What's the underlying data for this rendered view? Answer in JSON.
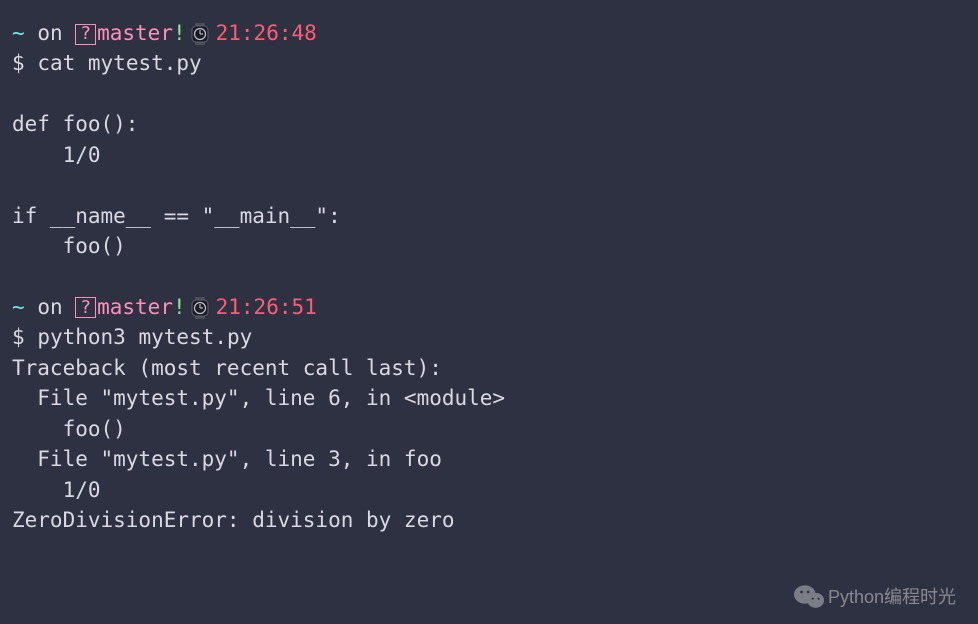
{
  "prompt1": {
    "tilde": "~",
    "on": "on",
    "branch": "master",
    "bang": "!",
    "time": "21:26:48",
    "dollar": "$",
    "command": "cat mytest.py"
  },
  "file": {
    "l1": "def foo():",
    "l2": "    1/0",
    "l3": "if __name__ == \"__main__\":",
    "l4": "    foo()"
  },
  "prompt2": {
    "tilde": "~",
    "on": "on",
    "branch": "master",
    "bang": "!",
    "time": "21:26:51",
    "dollar": "$",
    "command": "python3 mytest.py"
  },
  "trace": {
    "l1": "Traceback (most recent call last):",
    "l2": "  File \"mytest.py\", line 6, in <module>",
    "l3": "    foo()",
    "l4": "  File \"mytest.py\", line 3, in foo",
    "l5": "    1/0",
    "l6": "ZeroDivisionError: division by zero"
  },
  "watermark": "Python编程时光"
}
